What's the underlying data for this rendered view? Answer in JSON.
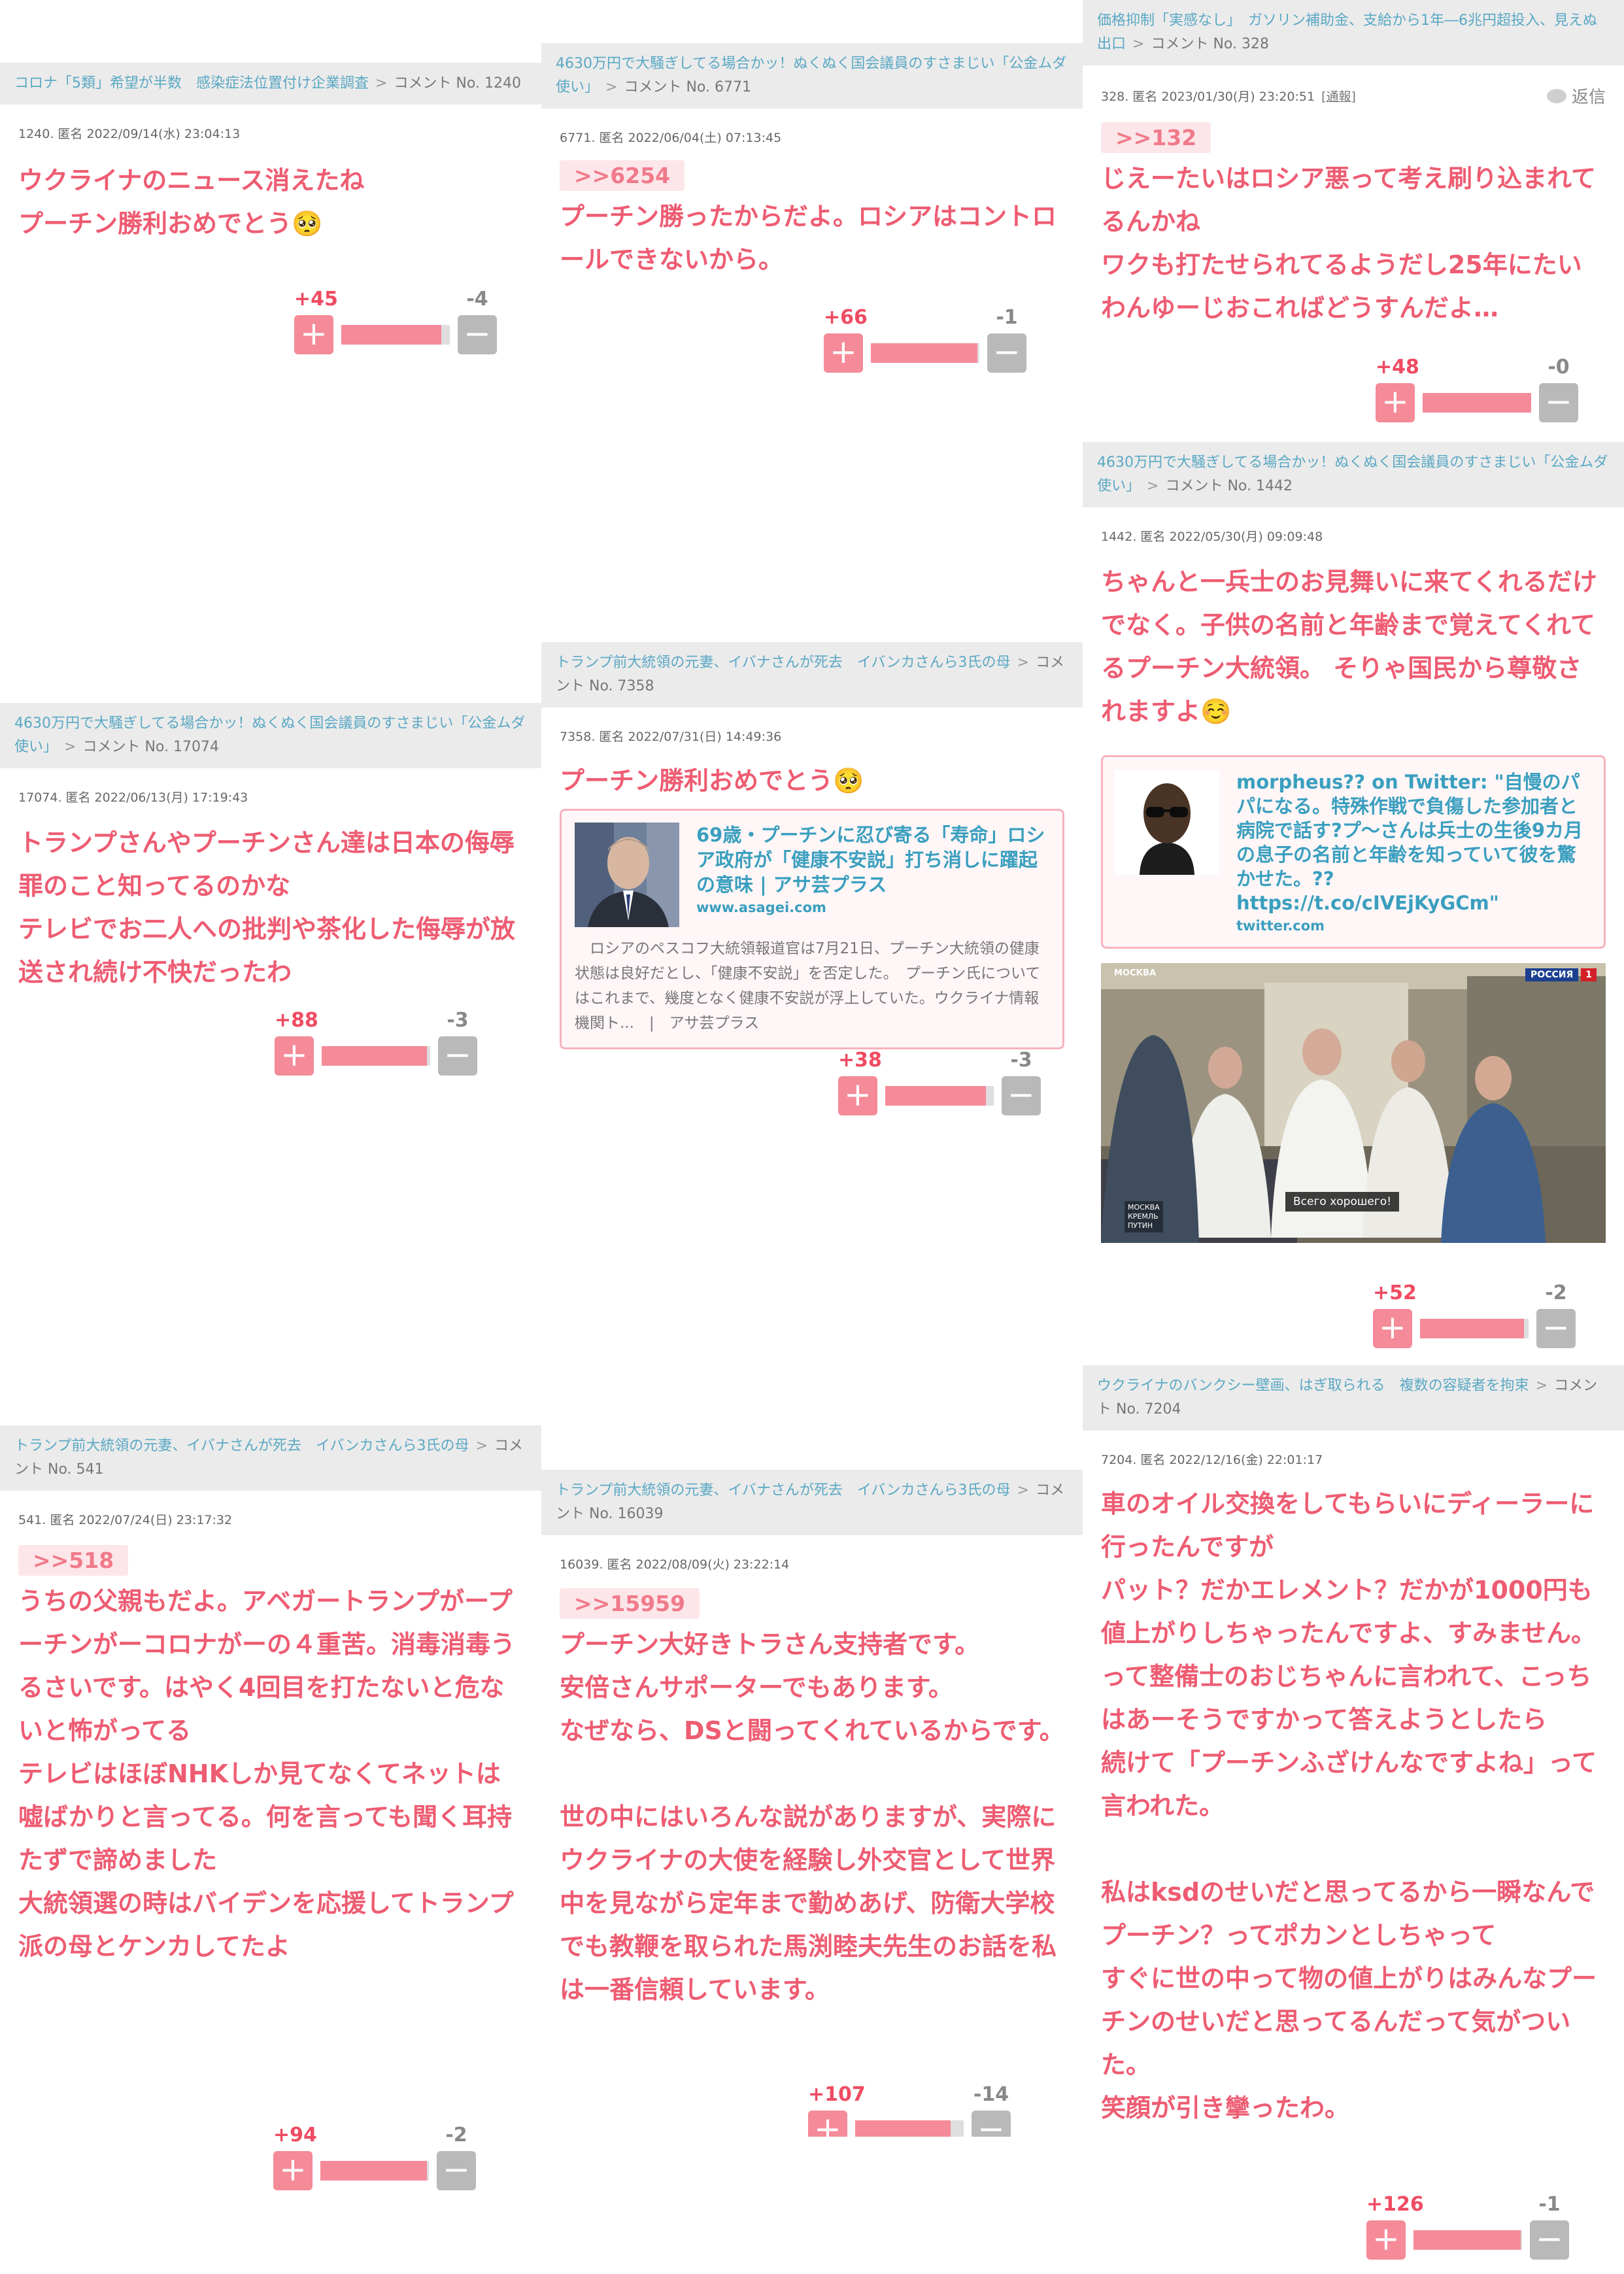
{
  "cards": [
    {
      "topic": "コロナ「5類」希望が半数　感染症法位置付け企業調査",
      "comment_no": "コメント No. 1240",
      "meta": "1240. 匿名 2022/09/14(水) 23:04:13",
      "body": "ウクライナのニュース消えたね\nプーチン勝利おめでとう🥺",
      "plus": "+45",
      "minus": "-4",
      "ratio": 0.92
    },
    {
      "topic": "4630万円で大騒ぎしてる場合かッ！ぬくぬく国会議員のすさまじい「公金ムダ使い」",
      "comment_no": "コメント No. 6771",
      "meta": "6771. 匿名 2022/06/04(土) 07:13:45",
      "anchor": ">>6254",
      "body": "プーチン勝ったからだよ。ロシアはコントロールできないから。",
      "plus": "+66",
      "minus": "-1",
      "ratio": 0.98
    },
    {
      "topic": "価格抑制「実感なし」　ガソリン補助金、支給から1年―6兆円超投入、見えぬ出口",
      "comment_no": "コメント No. 328",
      "meta": "328. 匿名 2023/01/30(月) 23:20:51",
      "report": "[通報]",
      "reply": "返信",
      "anchor": ">>132",
      "body": "じえーたいはロシア悪って考え刷り込まれてるんかね\nワクも打たせられてるようだし25年にたいわんゆーじおこればどうすんだよ…",
      "plus": "+48",
      "minus": "-0",
      "ratio": 1.0
    },
    {
      "topic": "4630万円で大騒ぎしてる場合かッ！ぬくぬく国会議員のすさまじい「公金ムダ使い」",
      "comment_no": "コメント No. 17074",
      "meta": "17074. 匿名 2022/06/13(月) 17:19:43",
      "body": "トランプさんやプーチンさん達は日本の侮辱罪のこと知ってるのかな\nテレビでお二人への批判や茶化した侮辱が放送され続け不快だったわ",
      "plus": "+88",
      "minus": "-3",
      "ratio": 0.97
    },
    {
      "topic": "トランプ前大統領の元妻、イバナさんが死去　イバンカさんら3氏の母",
      "comment_no": "コメント No. 7358",
      "meta": "7358. 匿名 2022/07/31(日) 14:49:36",
      "body": "プーチン勝利おめでとう🥺",
      "link": {
        "title": "69歳・プーチンに忍び寄る「寿命」ロシア政府が「健康不安説」打ち消しに躍起の意味 | アサ芸プラス",
        "domain": "www.asagei.com",
        "desc": "　ロシアのペスコフ大統領報道官は7月21日、プーチン大統領の健康状態は良好だとし、「健康不安説」を否定した。　プーチン氏についてはこれまで、幾度となく健康不安説が浮上していた。ウクライナ情報機関ト...　|　アサ芸プラス"
      },
      "plus": "+38",
      "minus": "-3",
      "ratio": 0.93
    },
    {
      "topic": "4630万円で大騒ぎしてる場合かッ！ぬくぬく国会議員のすさまじい「公金ムダ使い」",
      "comment_no": "コメント No. 1442",
      "meta": "1442. 匿名 2022/05/30(月) 09:09:48",
      "body": "ちゃんと一兵士のお見舞いに来てくれるだけでなく。子供の名前と年齢まで覚えてくれてるプーチン大統領。 そりゃ国民から尊敬されますよ☺️",
      "link": {
        "title": "morpheus?? on Twitter: \"自慢のパパになる。特殊作戦で負傷した参加者と病院で話す?プ～さんは兵士の生後9カ月の息子の名前と年齢を知っていて彼を驚かせた。?? https://t.co/cIVEjKyGCm\"",
        "domain": "twitter.com"
      },
      "photo": {
        "channel_left": "МОСКВА",
        "channel_right": "РОССИЯ",
        "channel_num": "1",
        "corner": "МОСКВА\nКРЕМЛЬ\nПУТИН",
        "caption": "Всего хорошего!"
      },
      "plus": "+52",
      "minus": "-2",
      "ratio": 0.96
    },
    {
      "topic": "ウクライナのバンクシー壁画、はぎ取られる　複数の容疑者を拘束",
      "comment_no": "コメント No. 7204",
      "meta": "7204. 匿名 2022/12/16(金) 22:01:17",
      "body": "車のオイル交換をしてもらいにディーラーに行ったんですが\nパット？だかエレメント？だかが1000円も値上がりしちゃったんですよ、すみません。って整備士のおじちゃんに言われて、こっちはあーそうですかって答えようとしたら\n続けて「プーチンふざけんなですよね」って言われた。\n\n私はksdのせいだと思ってるから一瞬なんでプーチン？ってポカンとしちゃって\nすぐに世の中って物の値上がりはみんなプーチンのせいだと思ってるんだって気がついた。\n笑顔が引き攣ったわ。",
      "plus": "+126",
      "minus": "-1",
      "ratio": 0.99
    },
    {
      "topic": "トランプ前大統領の元妻、イバナさんが死去　イバンカさんら3氏の母",
      "comment_no": "コメント No. 541",
      "meta": "541. 匿名 2022/07/24(日) 23:17:32",
      "anchor": ">>518",
      "body": "うちの父親もだよ。アベガートランプがープーチンがーコロナがーの４重苦。消毒消毒うるさいです。はやく4回目を打たないと危ないと怖がってる\nテレビはほぼNHKしか見てなくてネットは嘘ばかりと言ってる。何を言っても聞く耳持たずで諦めました\n大統領選の時はバイデンを応援してトランプ派の母とケンカしてたよ",
      "plus": "+94",
      "minus": "-2",
      "ratio": 0.98
    },
    {
      "topic": "トランプ前大統領の元妻、イバナさんが死去　イバンカさんら3氏の母",
      "comment_no": "コメント No. 16039",
      "meta": "16039. 匿名 2022/08/09(火) 23:22:14",
      "anchor": ">>15959",
      "body": "プーチン大好きトラさん支持者です。\n安倍さんサポーターでもあります。\nなぜなら、DSと闘ってくれているからです。\n\n世の中にはいろんな説がありますが、実際にウクライナの大使を経験し外交官として世界中を見ながら定年まで勤めあげ、防衛大学校でも教鞭を取られた馬渕睦夫先生のお話を私は一番信頼しています。",
      "plus": "+107",
      "minus": "-14",
      "ratio": 0.88
    }
  ]
}
